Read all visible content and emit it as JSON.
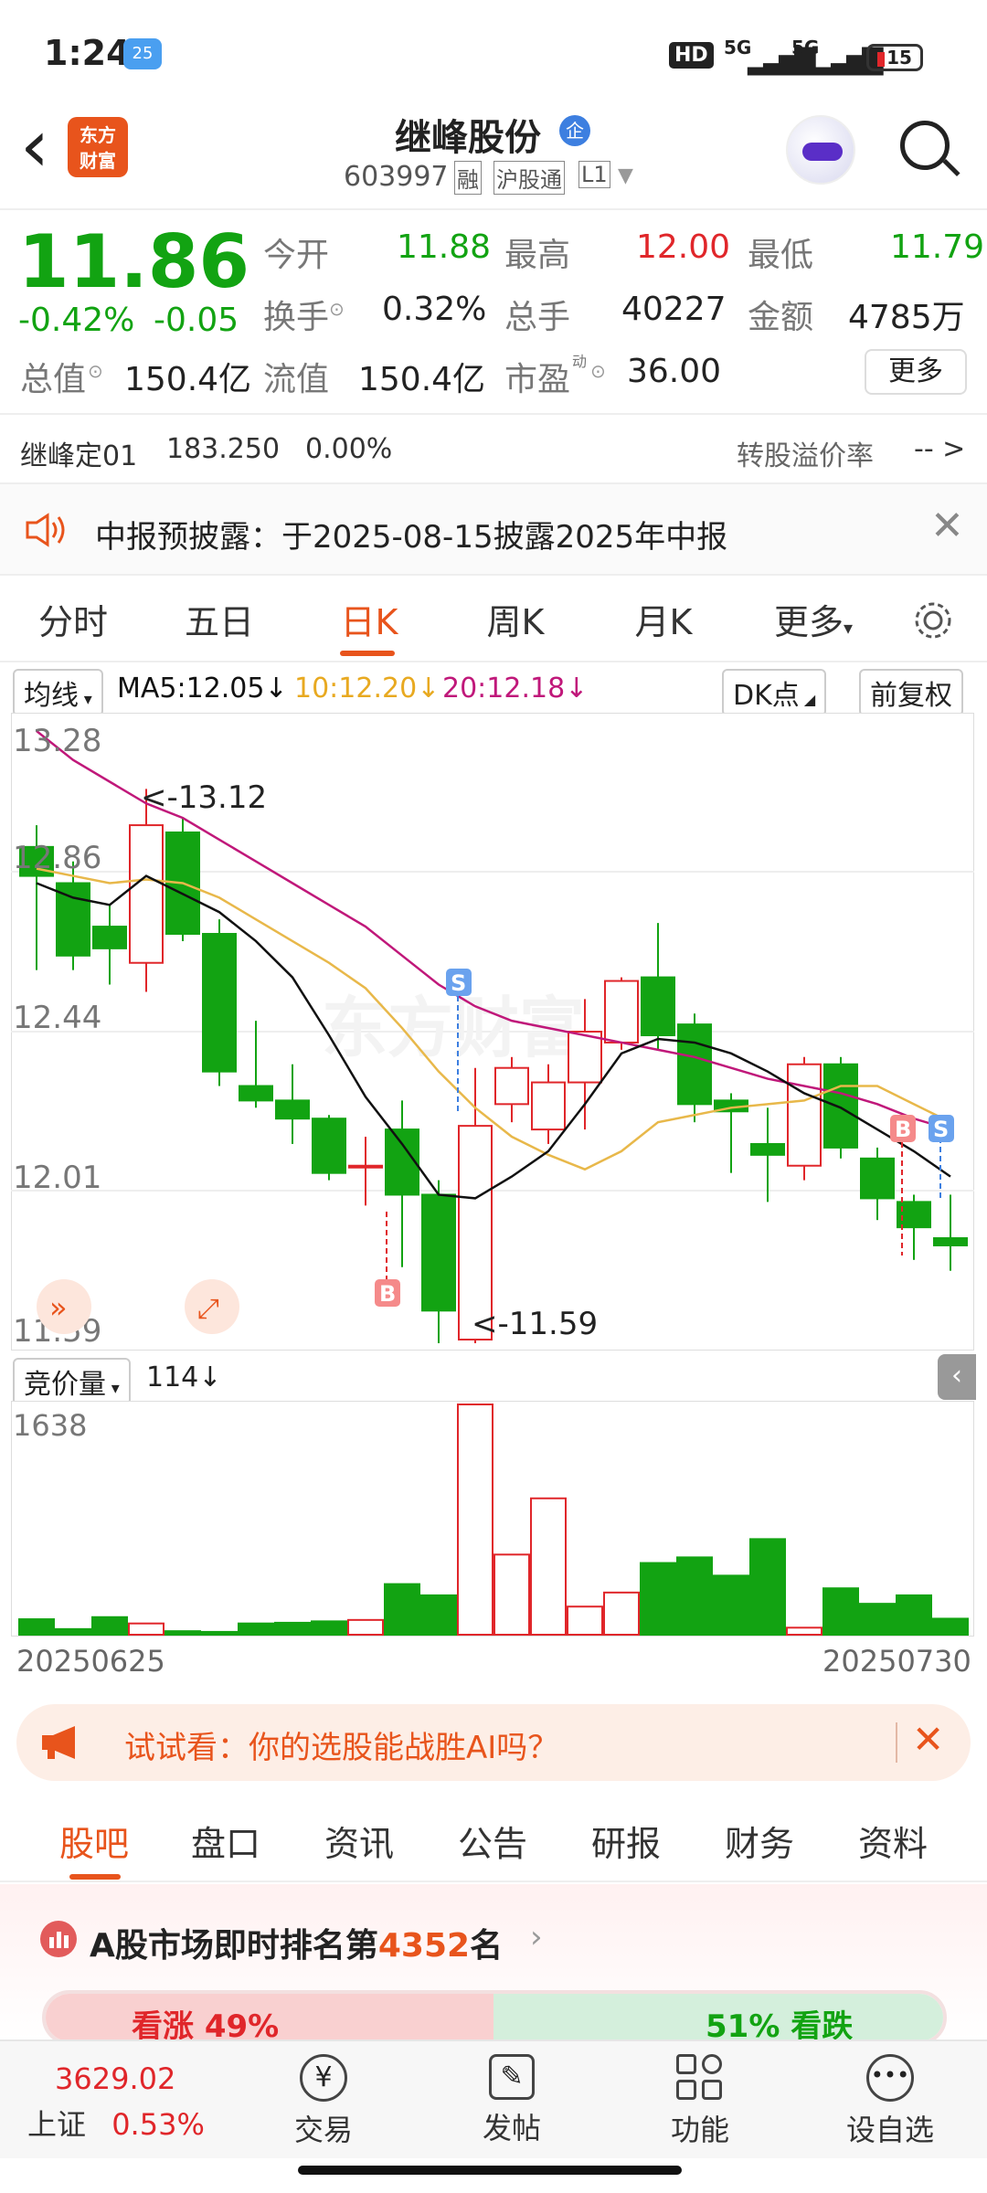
{
  "status": {
    "time": "1:24",
    "weather": "25",
    "hd": "HD",
    "sim1": "5G",
    "sim2": "5G",
    "battery": "15"
  },
  "header": {
    "back": "‹",
    "logo_line1": "东方",
    "logo_line2": "财富",
    "title": "继峰股份",
    "badge": "企",
    "code": "603997",
    "tag_rong": "融",
    "tag_hgt": "沪股通",
    "tag_l1": "L1"
  },
  "quote": {
    "price": "11.86",
    "pct": "-0.42%",
    "chg": "-0.05",
    "jin_kai_l": "今开",
    "jin_kai": "11.88",
    "zui_gao_l": "最高",
    "zui_gao": "12.00",
    "zui_di_l": "最低",
    "zui_di": "11.79",
    "huan_shou_l": "换手",
    "huan_shou": "0.32%",
    "zong_shou_l": "总手",
    "zong_shou": "40227",
    "jin_e_l": "金额",
    "jin_e": "4785万",
    "zong_zhi_l": "总值",
    "zong_zhi": "150.4亿",
    "liu_zhi_l": "流值",
    "liu_zhi": "150.4亿",
    "shi_ying_l": "市盈",
    "shi_ying_sup": "动",
    "shi_ying": "36.00",
    "more": "更多",
    "bond_name": "继峰定01",
    "bond_price": "183.250",
    "bond_pct": "0.00%",
    "premium_l": "转股溢价率",
    "premium": "-- >"
  },
  "notice": {
    "text": "中报预披露：于2025-08-15披露2025年中报"
  },
  "tabs": [
    "分时",
    "五日",
    "日K",
    "周K",
    "月K",
    "更多"
  ],
  "active_tab": "日K",
  "ma": {
    "selector": "均线",
    "ma5": "MA5:12.05",
    "ma10": "10:12.20",
    "ma20": "20:12.18",
    "dk": "DK点",
    "fq": "前复权"
  },
  "kchart_labels": {
    "y1": "13.28",
    "y2": "12.86",
    "y3": "12.44",
    "y4": "12.01",
    "y5": "11.59",
    "hi": "<-13.12",
    "lo": "<-11.59",
    "b": "B",
    "s": "S",
    "watermark": "东方财富"
  },
  "vol": {
    "selector": "竞价量",
    "value": "114",
    "max": "1638"
  },
  "dates": {
    "start": "20250625",
    "end": "20250730"
  },
  "ai_banner": {
    "text": "试试看：你的选股能战胜AI吗？"
  },
  "bottom_tabs": [
    "股吧",
    "盘口",
    "资讯",
    "公告",
    "研报",
    "财务",
    "资料"
  ],
  "rank": {
    "prefix": "A股市场即时排名第",
    "rank": "4352",
    "suffix": "名",
    "up": "看涨 49%",
    "down": "51% 看跌"
  },
  "bottom_nav": {
    "index_value": "3629.02",
    "index_name": "上证",
    "index_pct": "0.53%",
    "trade": "交易",
    "post": "发帖",
    "func": "功能",
    "watch": "设自选"
  },
  "colors": {
    "up": "#e0262a",
    "down": "#12a312",
    "ma5": "#111111",
    "ma10": "#e8b84a",
    "ma20": "#c0187a",
    "accent": "#e8541c"
  },
  "chart_data": {
    "type": "candlestick",
    "ylim": [
      11.59,
      13.28
    ],
    "candles": [
      {
        "o": 12.96,
        "c": 12.88,
        "h": 13.02,
        "l": 12.62
      },
      {
        "o": 12.86,
        "c": 12.66,
        "h": 12.92,
        "l": 12.62
      },
      {
        "o": 12.74,
        "c": 12.68,
        "h": 12.8,
        "l": 12.58
      },
      {
        "o": 12.64,
        "c": 13.02,
        "h": 13.12,
        "l": 12.56
      },
      {
        "o": 13.0,
        "c": 12.72,
        "h": 13.04,
        "l": 12.7
      },
      {
        "o": 12.72,
        "c": 12.34,
        "h": 12.76,
        "l": 12.3
      },
      {
        "o": 12.3,
        "c": 12.26,
        "h": 12.48,
        "l": 12.24
      },
      {
        "o": 12.26,
        "c": 12.21,
        "h": 12.36,
        "l": 12.14
      },
      {
        "o": 12.21,
        "c": 12.06,
        "h": 12.22,
        "l": 12.04
      },
      {
        "o": 12.08,
        "c": 12.08,
        "h": 12.16,
        "l": 11.97
      },
      {
        "o": 12.18,
        "c": 12.0,
        "h": 12.26,
        "l": 11.8
      },
      {
        "o": 12.0,
        "c": 11.68,
        "h": 12.04,
        "l": 11.59
      },
      {
        "o": 11.6,
        "c": 12.19,
        "h": 12.35,
        "l": 11.59
      },
      {
        "o": 12.25,
        "c": 12.35,
        "h": 12.38,
        "l": 12.2
      },
      {
        "o": 12.18,
        "c": 12.31,
        "h": 12.36,
        "l": 12.14
      },
      {
        "o": 12.31,
        "c": 12.45,
        "h": 12.54,
        "l": 12.18
      },
      {
        "o": 12.42,
        "c": 12.59,
        "h": 12.6,
        "l": 12.4
      },
      {
        "o": 12.6,
        "c": 12.44,
        "h": 12.75,
        "l": 12.4
      },
      {
        "o": 12.47,
        "c": 12.25,
        "h": 12.5,
        "l": 12.2
      },
      {
        "o": 12.26,
        "c": 12.23,
        "h": 12.28,
        "l": 12.06
      },
      {
        "o": 12.14,
        "c": 12.11,
        "h": 12.24,
        "l": 11.98
      },
      {
        "o": 12.08,
        "c": 12.36,
        "h": 12.38,
        "l": 12.04
      },
      {
        "o": 12.36,
        "c": 12.13,
        "h": 12.38,
        "l": 12.1
      },
      {
        "o": 12.1,
        "c": 11.99,
        "h": 12.13,
        "l": 11.93
      },
      {
        "o": 11.98,
        "c": 11.91,
        "h": 12.0,
        "l": 11.82
      },
      {
        "o": 11.88,
        "c": 11.86,
        "h": 12.0,
        "l": 11.79
      }
    ],
    "ma5": [
      12.86,
      12.82,
      12.8,
      12.88,
      12.83,
      12.78,
      12.7,
      12.6,
      12.44,
      12.27,
      12.14,
      12.0,
      11.99,
      12.05,
      12.12,
      12.25,
      12.39,
      12.43,
      12.42,
      12.39,
      12.34,
      12.28,
      12.24,
      12.18,
      12.12,
      12.05
    ],
    "ma10": [
      12.9,
      12.88,
      12.86,
      12.87,
      12.86,
      12.82,
      12.76,
      12.7,
      12.64,
      12.57,
      12.46,
      12.34,
      12.24,
      12.16,
      12.11,
      12.07,
      12.12,
      12.2,
      12.22,
      12.24,
      12.25,
      12.26,
      12.3,
      12.3,
      12.25,
      12.2
    ],
    "ma20": [
      13.28,
      13.2,
      13.14,
      13.08,
      13.04,
      12.98,
      12.92,
      12.86,
      12.8,
      12.74,
      12.66,
      12.58,
      12.52,
      12.48,
      12.46,
      12.44,
      12.42,
      12.4,
      12.38,
      12.35,
      12.32,
      12.3,
      12.28,
      12.25,
      12.21,
      12.18
    ],
    "volume": [
      110,
      40,
      125,
      80,
      25,
      20,
      80,
      85,
      95,
      105,
      360,
      280,
      1638,
      570,
      970,
      200,
      300,
      510,
      550,
      420,
      680,
      50,
      330,
      220,
      280,
      114
    ]
  }
}
